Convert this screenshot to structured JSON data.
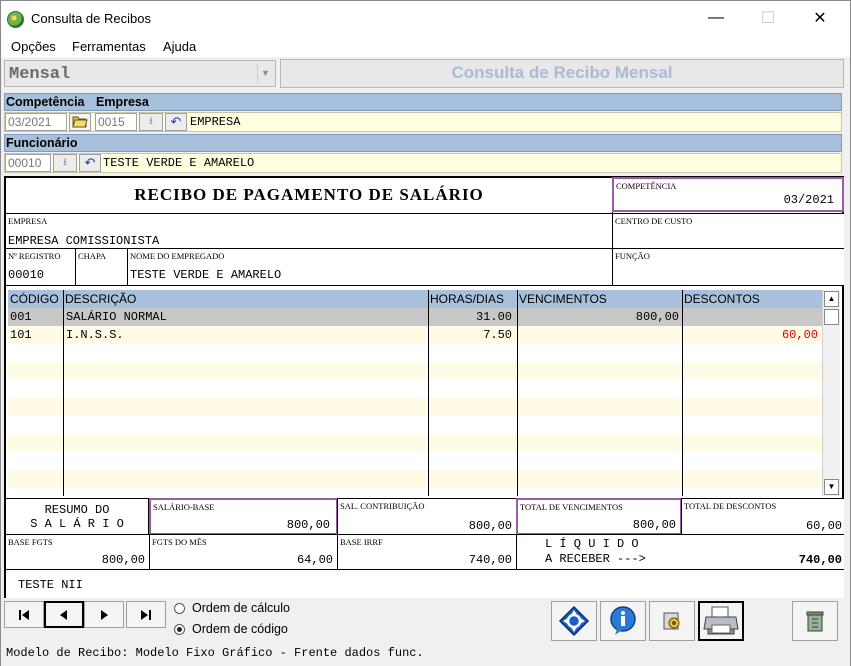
{
  "window": {
    "title": "Consulta de Recibos",
    "minimize": "—",
    "maximize": "☐",
    "close": "✕"
  },
  "menu": [
    "Opções",
    "Ferramentas",
    "Ajuda"
  ],
  "period_combo": {
    "value": "Mensal"
  },
  "header_title": "Consulta de Recibo Mensal",
  "filters": {
    "competencia_label": "Competência",
    "empresa_label": "Empresa",
    "competencia_value": "03/2021",
    "empresa_code": "0015",
    "empresa_name": "EMPRESA",
    "funcionario_label": "Funcionário",
    "funcionario_code": "00010",
    "funcionario_name": "TESTE VERDE E AMARELO"
  },
  "receipt": {
    "title": "RECIBO DE PAGAMENTO DE SALÁRIO",
    "competencia_label": "COMPETÊNCIA",
    "competencia": "03/2021",
    "empresa_label": "EMPRESA",
    "empresa": "EMPRESA COMISSIONISTA",
    "centro_custo_label": "CENTRO DE CUSTO",
    "registro_label": "Nº REGISTRO",
    "registro": "00010",
    "chapa_label": "CHAPA",
    "nome_label": "NOME DO EMPREGADO",
    "nome": "TESTE VERDE E AMARELO",
    "funcao_label": "FUNÇÃO"
  },
  "grid": {
    "columns": [
      "CÓDIGO",
      "DESCRIÇÃO",
      "HORAS/DIAS",
      "VENCIMENTOS",
      "DESCONTOS"
    ],
    "rows": [
      {
        "codigo": "001",
        "descricao": "SALÁRIO NORMAL",
        "horas": "31.00",
        "vencimentos": "800,00",
        "descontos": ""
      },
      {
        "codigo": "101",
        "descricao": "I.N.S.S.",
        "horas": "7.50",
        "vencimentos": "",
        "descontos": "60,00"
      }
    ]
  },
  "summary": {
    "resumo_line1": "RESUMO DO",
    "resumo_line2": "S A L Á R I O",
    "salario_base_label": "SALÁRIO-BASE",
    "salario_base": "800,00",
    "sal_contribuicao_label": "SAL. CONTRIBUIÇÃO",
    "sal_contribuicao": "800,00",
    "total_vencimentos_label": "TOTAL DE VENCIMENTOS",
    "total_vencimentos": "800,00",
    "total_descontos_label": "TOTAL DE DESCONTOS",
    "total_descontos": "60,00",
    "base_fgts_label": "BASE FGTS",
    "base_fgts": "800,00",
    "fgts_mes_label": "FGTS DO MÊS",
    "fgts_mes": "64,00",
    "base_irrf_label": "BASE IRRF",
    "base_irrf": "740,00",
    "liquido_line1": "L Í Q U I D O",
    "liquido_line2": "A RECEBER --->",
    "liquido": "740,00",
    "note": "TESTE NII"
  },
  "order": {
    "calculo_label": "Ordem de cálculo",
    "codigo_label": "Ordem de código",
    "selected": "codigo"
  },
  "status": "Modelo de Recibo: Modelo Fixo Gráfico - Frente dados func.",
  "colors": {
    "accent_blue": "#a8c0dc",
    "highlight_purple": "#9b5aa6",
    "discount_red": "#e00000",
    "row_yellow": "#ffffe0"
  }
}
